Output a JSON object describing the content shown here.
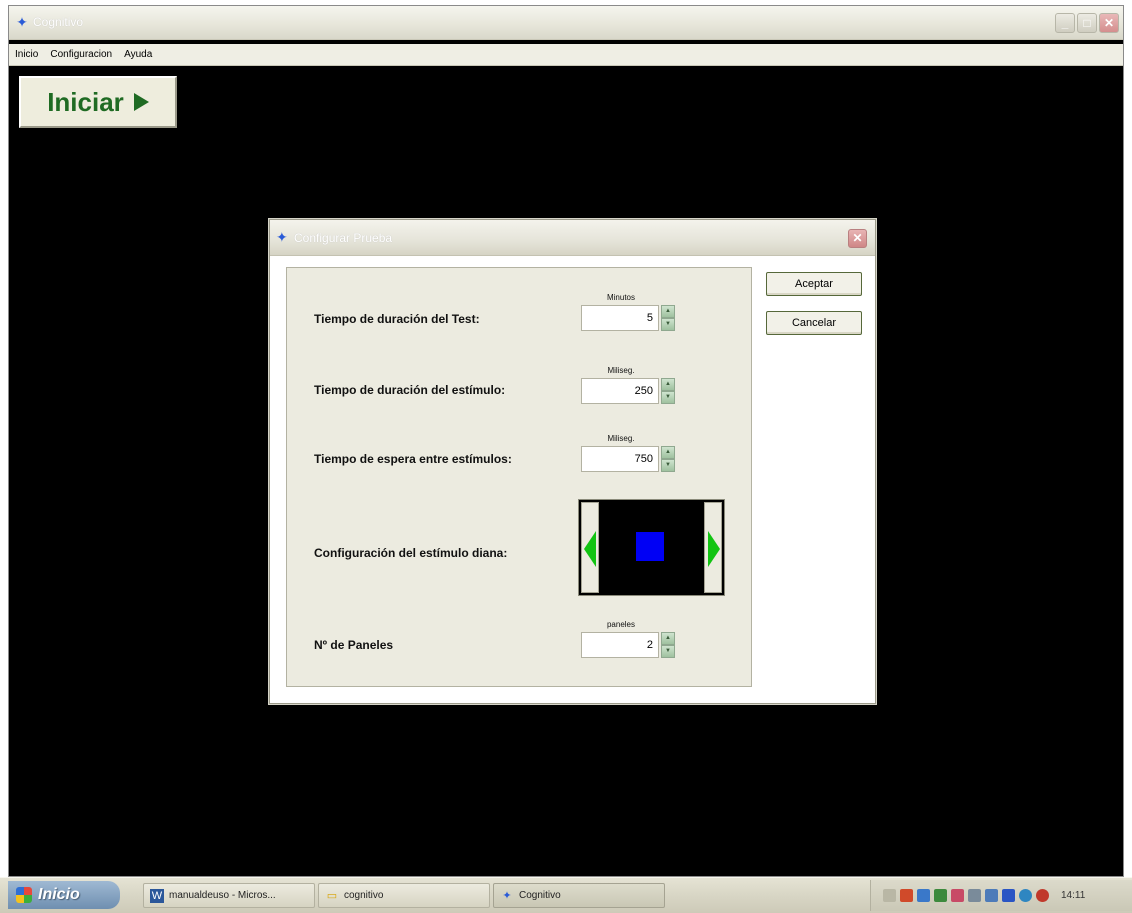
{
  "app": {
    "title": "Cognitivo",
    "menu": [
      "Inicio",
      "Configuracion",
      "Ayuda"
    ],
    "start_button_label": "Iniciar"
  },
  "dialog": {
    "title": "Configurar Prueba",
    "fields": {
      "test_duration": {
        "label": "Tiempo de duración del Test:",
        "unit": "Minutos",
        "value": "5"
      },
      "stimulus_duration": {
        "label": "Tiempo de duración del estímulo:",
        "unit": "Miliseg.",
        "value": "250"
      },
      "wait_between": {
        "label": "Tiempo de espera entre estímulos:",
        "unit": "Miliseg.",
        "value": "750"
      },
      "target_config": {
        "label": "Configuración del estímulo diana:"
      },
      "panels": {
        "label": "Nº de Paneles",
        "unit": "paneles",
        "value": "2"
      }
    },
    "buttons": {
      "accept": "Aceptar",
      "cancel": "Cancelar"
    },
    "colors": {
      "stimulus_square": "#0000f5",
      "arrow": "#12c412"
    }
  },
  "taskbar": {
    "start_label": "Inicio",
    "tasks": [
      {
        "label": "manualdeuso - Micros..."
      },
      {
        "label": "cognitivo"
      },
      {
        "label": "Cognitivo"
      }
    ],
    "time": "14:11"
  }
}
